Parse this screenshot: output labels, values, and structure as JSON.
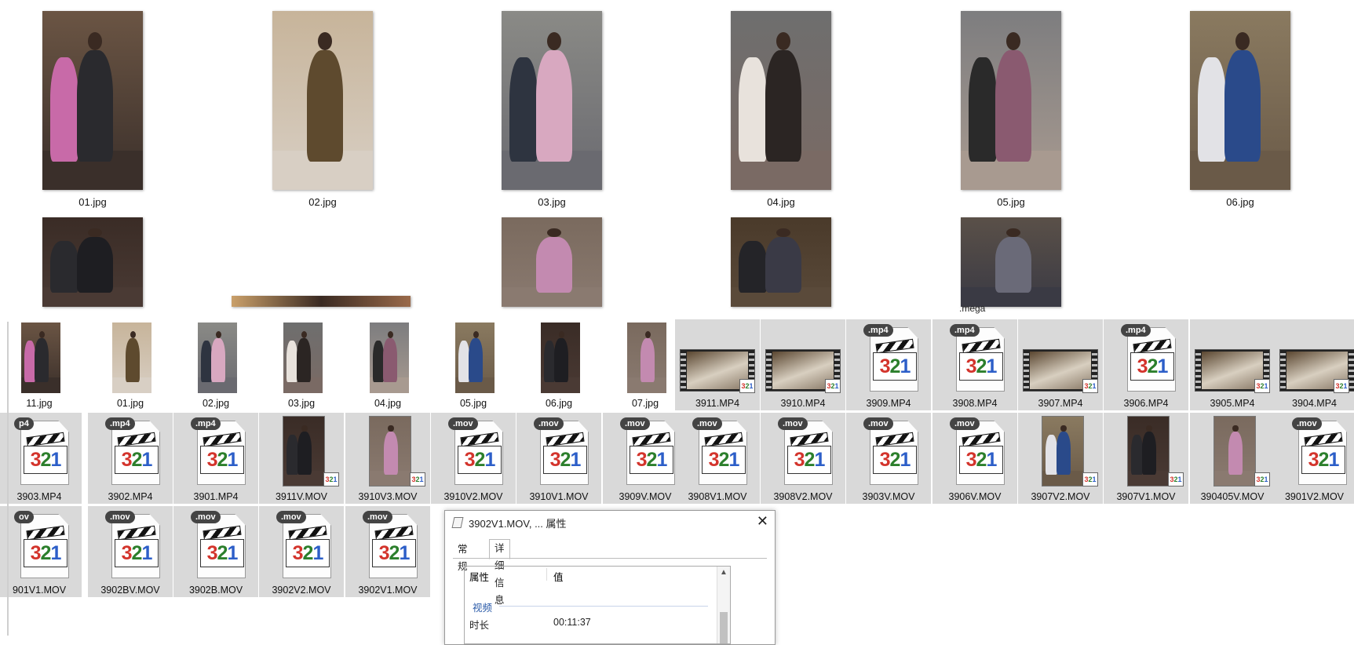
{
  "top_grid": [
    {
      "label": "01.jpg"
    },
    {
      "label": "02.jpg"
    },
    {
      "label": "03.jpg"
    },
    {
      "label": "04.jpg"
    },
    {
      "label": "05.jpg"
    },
    {
      "label": "06.jpg"
    }
  ],
  "top_row2_caption": ".mega",
  "tiles_row1": [
    {
      "label": "11.jpg",
      "kind": "photo"
    },
    {
      "label": "01.jpg",
      "kind": "photo"
    },
    {
      "label": "02.jpg",
      "kind": "photo"
    },
    {
      "label": "03.jpg",
      "kind": "photo"
    },
    {
      "label": "04.jpg",
      "kind": "photo"
    },
    {
      "label": "05.jpg",
      "kind": "photo"
    },
    {
      "label": "06.jpg",
      "kind": "photo"
    },
    {
      "label": "07.jpg",
      "kind": "photo"
    },
    {
      "label": "3911.MP4",
      "kind": "video-thumb"
    },
    {
      "label": "3910.MP4",
      "kind": "video-thumb"
    },
    {
      "label": "3909.MP4",
      "kind": "media",
      "ext": ".mp4"
    },
    {
      "label": "3908.MP4",
      "kind": "media",
      "ext": ".mp4"
    },
    {
      "label": "3907.MP4",
      "kind": "video-thumb"
    },
    {
      "label": "3906.MP4",
      "kind": "media",
      "ext": ".mp4"
    },
    {
      "label": "3905.MP4",
      "kind": "video-thumb"
    },
    {
      "label": "3904.MP4",
      "kind": "video-thumb"
    }
  ],
  "tiles_row2": [
    {
      "label": "3903.MP4",
      "kind": "media",
      "ext": "p4"
    },
    {
      "label": "3902.MP4",
      "kind": "media",
      "ext": ".mp4"
    },
    {
      "label": "3901.MP4",
      "kind": "media",
      "ext": ".mp4"
    },
    {
      "label": "3911V.MOV",
      "kind": "video-tall"
    },
    {
      "label": "3910V3.MOV",
      "kind": "video-tall"
    },
    {
      "label": "3910V2.MOV",
      "kind": "media",
      "ext": ".mov"
    },
    {
      "label": "3910V1.MOV",
      "kind": "media",
      "ext": ".mov"
    },
    {
      "label": "3909V.MOV",
      "kind": "media",
      "ext": ".mov"
    },
    {
      "label": "3908V1.MOV",
      "kind": "media",
      "ext": ".mov"
    },
    {
      "label": "3908V2.MOV",
      "kind": "media",
      "ext": ".mov"
    },
    {
      "label": "3903V.MOV",
      "kind": "media",
      "ext": ".mov"
    },
    {
      "label": "3906V.MOV",
      "kind": "media",
      "ext": ".mov"
    },
    {
      "label": "3907V2.MOV",
      "kind": "video-tall"
    },
    {
      "label": "3907V1.MOV",
      "kind": "video-tall"
    },
    {
      "label": "390405V.MOV",
      "kind": "video-tall"
    },
    {
      "label": "3901V2.MOV",
      "kind": "media",
      "ext": ".mov"
    }
  ],
  "tiles_row3": [
    {
      "label": "901V1.MOV",
      "kind": "media",
      "ext": "ov"
    },
    {
      "label": "3902BV.MOV",
      "kind": "media",
      "ext": ".mov"
    },
    {
      "label": "3902B.MOV",
      "kind": "media",
      "ext": ".mov"
    },
    {
      "label": "3902V2.MOV",
      "kind": "media",
      "ext": ".mov"
    },
    {
      "label": "3902V1.MOV",
      "kind": "media",
      "ext": ".mov"
    }
  ],
  "dialog": {
    "title": "3902V1.MOV, ... 属性",
    "close": "✕",
    "tabs": [
      "常规",
      "详细信息"
    ],
    "col_property": "属性",
    "col_value": "值",
    "group": "视频",
    "row_name": "时长",
    "row_value": "00:11:37"
  },
  "colors": {
    "selected_tile": "#d9d9d9",
    "group_text": "#2a5aa8"
  }
}
